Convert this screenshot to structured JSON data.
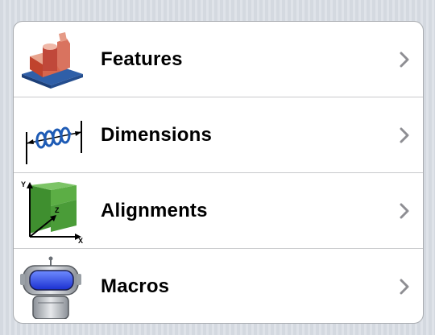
{
  "colors": {
    "background": "#d8dde4",
    "cell_background": "#ffffff",
    "separator": "#c8c9cc",
    "label_text": "#000000",
    "chevron": "#8e8e93"
  },
  "menu": {
    "items": [
      {
        "label": "Features",
        "icon": "features-icon"
      },
      {
        "label": "Dimensions",
        "icon": "dimensions-icon"
      },
      {
        "label": "Alignments",
        "icon": "alignments-icon"
      },
      {
        "label": "Macros",
        "icon": "macros-icon"
      }
    ]
  }
}
